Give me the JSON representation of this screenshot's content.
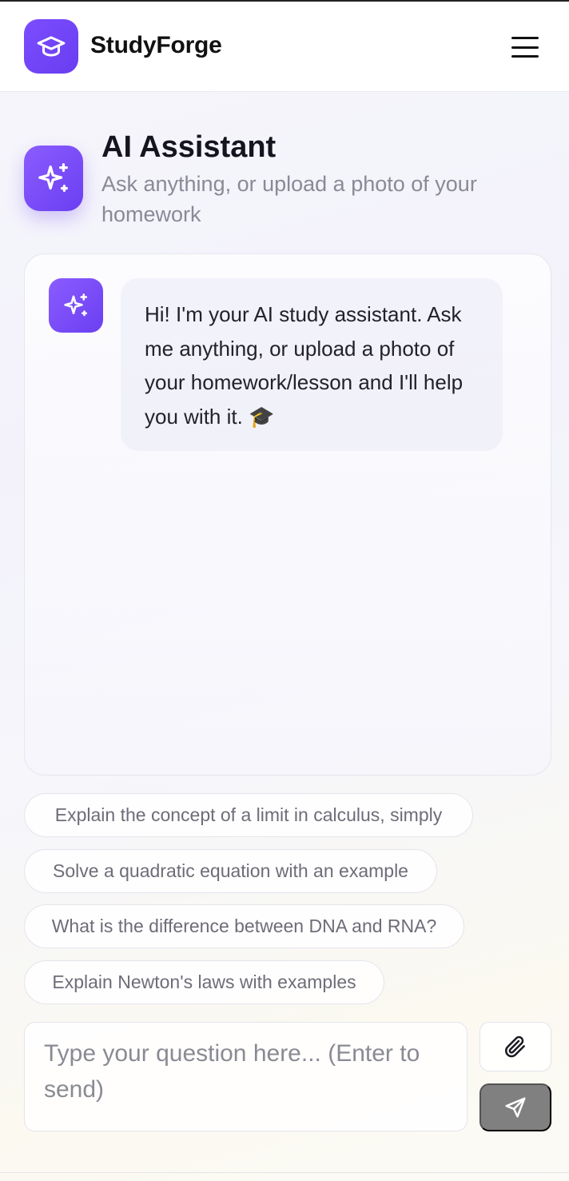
{
  "app": {
    "brand": "StudyForge",
    "accent": "#7246f5"
  },
  "header": {
    "logo_icon": "graduation-cap-icon",
    "menu_icon": "hamburger-menu-icon"
  },
  "hero": {
    "icon": "sparkles-icon",
    "title": "AI Assistant",
    "subtitle": "Ask anything, or upload a photo of your homework"
  },
  "chat": {
    "messages": [
      {
        "role": "assistant",
        "avatar_icon": "sparkles-icon",
        "text": "Hi! I'm your AI study assistant. Ask me anything, or upload a photo of your homework/lesson and I'll help you with it. 🎓"
      }
    ]
  },
  "suggestions": [
    "Explain the concept of a limit in calculus, simply",
    "Solve a quadratic equation with an example",
    "What is the difference between DNA and RNA?",
    "Explain Newton's laws with examples"
  ],
  "composer": {
    "placeholder": "Type your question here... (Enter to send)",
    "attach_icon": "paperclip-icon",
    "send_icon": "send-icon"
  }
}
